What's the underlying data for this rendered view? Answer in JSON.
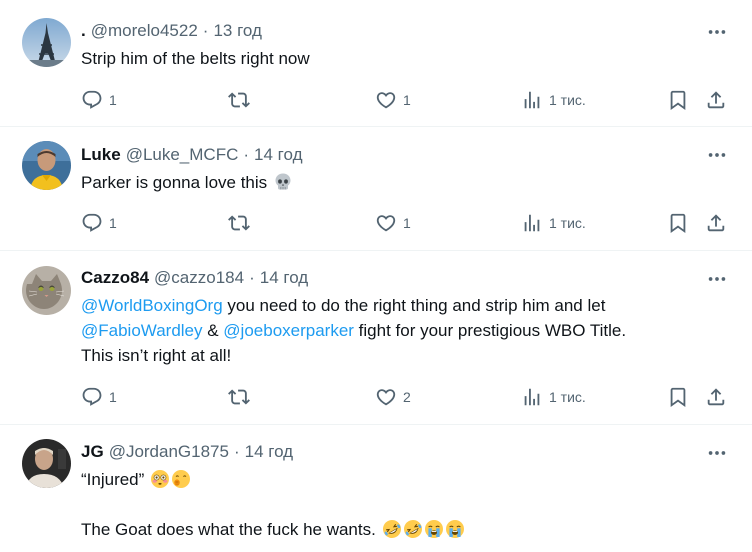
{
  "tweets": [
    {
      "name": ".",
      "handle": "@morelo4522",
      "separator": "·",
      "time": "13 год",
      "avatar": "eiffel-tower-avatar",
      "text": "Strip him of the belts right now",
      "replies": "1",
      "reposts": "",
      "likes": "1",
      "views": "1 тис."
    },
    {
      "name": "Luke",
      "handle": "@Luke_MCFC",
      "separator": "·",
      "time": "14 год",
      "avatar": "man-yellow-shirt-avatar",
      "text": "Parker is gonna love this",
      "emoji": "skull-emoji",
      "replies": "1",
      "reposts": "",
      "likes": "1",
      "views": "1 тис."
    },
    {
      "name": "Cazzo84",
      "handle": "@cazzo184",
      "separator": "·",
      "time": "14 год",
      "avatar": "cat-avatar",
      "mention1": "@WorldBoxingOrg",
      "text1": " you need to do the right thing and strip him and let",
      "mention2": "@FabioWardley",
      "text2": " & ",
      "mention3": "@joeboxerparker",
      "text3": " fight for your prestigious WBO Title.",
      "text4": "This isn’t right at all!",
      "replies": "1",
      "reposts": "",
      "likes": "2",
      "views": "1 тис."
    },
    {
      "name": "JG",
      "handle": "@JordanG1875",
      "separator": "·",
      "time": "14 год",
      "avatar": "man-avatar",
      "text1": "“Injured”",
      "emoji1": [
        "flushed-face-emoji",
        "face-with-hand-over-mouth-emoji"
      ],
      "text2": "The Goat does what the fuck he wants.",
      "emoji2": [
        "rolling-on-floor-laughing-emoji",
        "rolling-on-floor-laughing-emoji",
        "loudly-crying-face-emoji",
        "loudly-crying-face-emoji"
      ]
    }
  ],
  "colors": {
    "text": "#0f1419",
    "secondary": "#536471",
    "link": "#1d9bf0",
    "divider": "#eff3f4"
  }
}
